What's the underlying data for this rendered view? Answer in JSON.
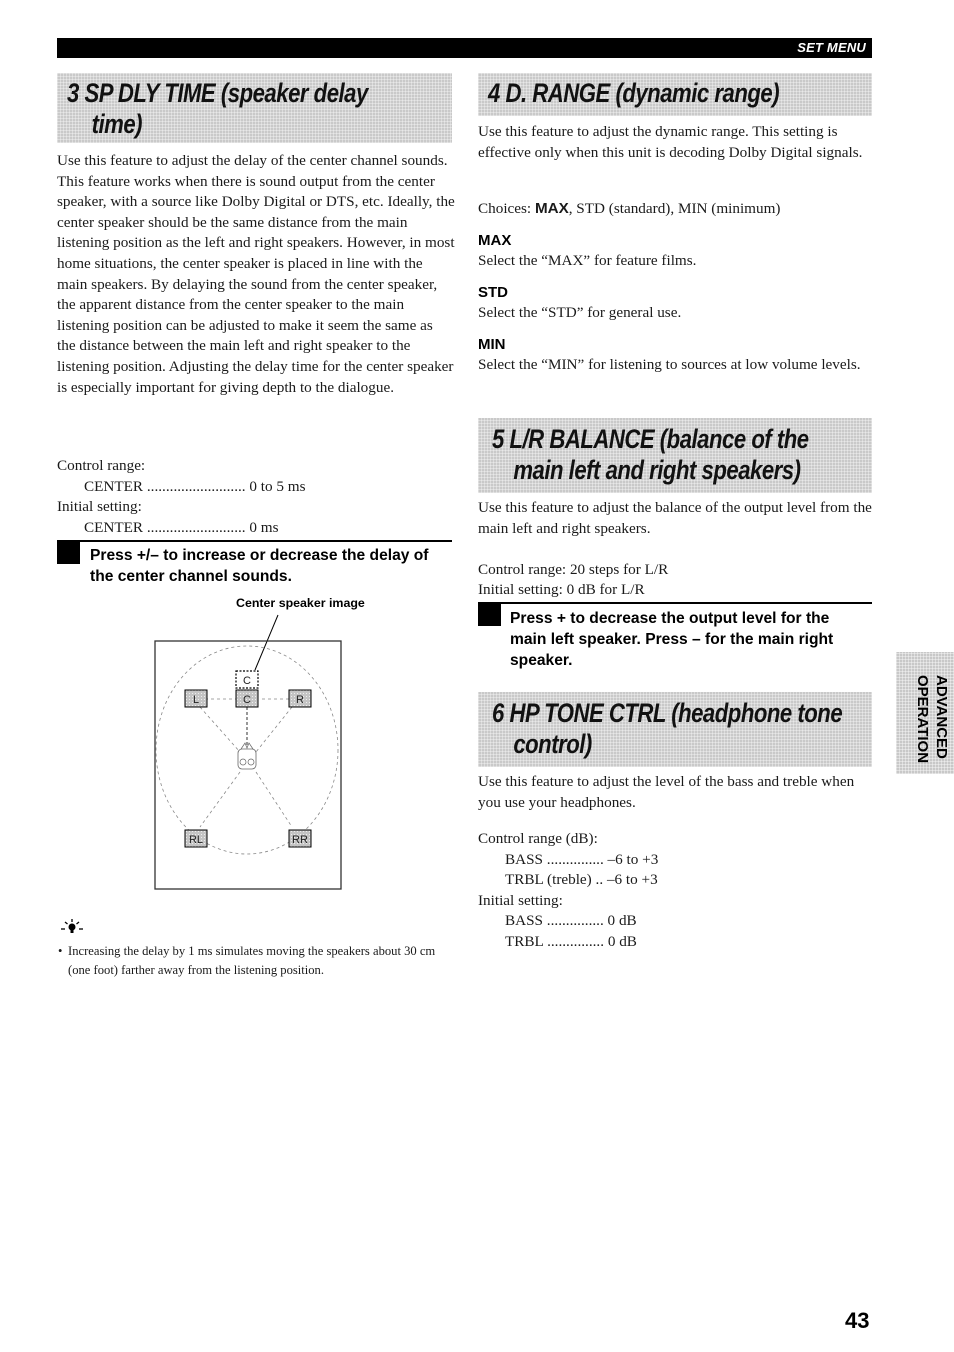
{
  "header": {
    "section_label": "SET MENU"
  },
  "left_column": {
    "section3": {
      "title_line1": "3  SP DLY TIME (speaker delay",
      "title_line2": "time)",
      "description": "Use this feature to adjust the delay of the center channel sounds. This feature works when there is sound output from the center speaker, with a source like Dolby Digital or DTS, etc. Ideally, the center speaker should be the same distance from the main listening position as the left and right speakers. However, in most home situations, the center speaker is placed in line with the main speakers. By delaying the sound from the center speaker, the apparent distance from the center speaker to the main listening position can be adjusted to make it seem the same as the distance between the main left and right speaker to the listening position. Adjusting the delay time for the center speaker is especially important for giving depth to the dialogue.",
      "control_range_label": "Control range:",
      "control_range": [
        {
          "name": "CENTER",
          "dots": "..........................",
          "value": "0 to 5 ms"
        }
      ],
      "initial_setting_label": "Initial setting:",
      "initial_setting": [
        {
          "name": "CENTER",
          "dots": "..........................",
          "value": "0 ms"
        }
      ],
      "instruction": "Press +/– to increase or decrease the delay of the center channel sounds.",
      "diagram": {
        "caption": "Center speaker image",
        "speakers": [
          {
            "id": "C-image",
            "label": "C"
          },
          {
            "id": "L",
            "label": "L"
          },
          {
            "id": "C",
            "label": "C"
          },
          {
            "id": "R",
            "label": "R"
          },
          {
            "id": "RL",
            "label": "RL"
          },
          {
            "id": "RR",
            "label": "RR"
          }
        ]
      },
      "tip": {
        "icon": "lightbulb-tip-icon",
        "text": "Increasing the delay by 1 ms simulates moving the speakers about 30 cm (one foot) farther away from the listening position."
      }
    }
  },
  "right_column": {
    "section4": {
      "title": "4  D. RANGE (dynamic range)",
      "description": "Use this feature to adjust the dynamic range. This setting is effective only when this unit is decoding Dolby Digital signals.",
      "choices_label": "Choices:",
      "choices_default": "MAX",
      "choices_rest": ", STD (standard), MIN (minimum)",
      "options": [
        {
          "name": "MAX",
          "text": "Select the “MAX” for feature films."
        },
        {
          "name": "STD",
          "text": "Select the “STD” for general use."
        },
        {
          "name": "MIN",
          "text": "Select the “MIN” for listening to sources at low volume levels."
        }
      ]
    },
    "section5": {
      "title_line1": "5 L/R BALANCE (balance of the",
      "title_line2": "main left and right speakers)",
      "description": "Use this feature to adjust the balance of the output level from the main left and right speakers.",
      "control_range": "Control range: 20 steps for L/R",
      "initial_setting": "Initial setting:  0 dB for L/R",
      "instruction": "Press + to decrease the output level for the main left speaker. Press – for the main right speaker."
    },
    "section6": {
      "title_line1": "6 HP TONE CTRL (headphone tone",
      "title_line2": "control)",
      "description": "Use this feature to adjust the level of the bass and treble when you use your headphones.",
      "control_range_label": "Control range (dB):",
      "control_range": [
        {
          "name": "BASS",
          "dots": "...............",
          "value": "–6 to +3"
        },
        {
          "name": "TRBL (treble)",
          "dots": "..",
          "value": "–6 to +3"
        }
      ],
      "initial_setting_label": "Initial setting:",
      "initial_setting": [
        {
          "name": "BASS",
          "dots": "...............",
          "value": "0 dB"
        },
        {
          "name": "TRBL",
          "dots": "...............",
          "value": "0 dB"
        }
      ]
    }
  },
  "side_tab": {
    "line1": "ADVANCED",
    "line2": "OPERATION"
  },
  "footer": {
    "page_number": "43"
  }
}
